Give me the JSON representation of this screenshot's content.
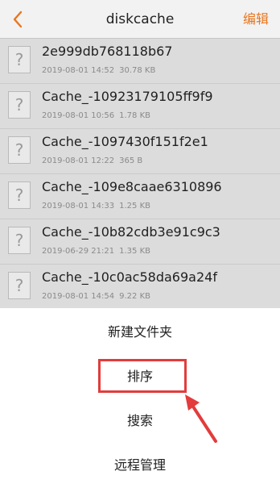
{
  "header": {
    "title": "diskcache",
    "edit_label": "编辑",
    "back_icon": "chevron-left-icon"
  },
  "files": [
    {
      "name": "2e999db768118b67",
      "date": "2019-08-01 14:52",
      "size": "30.78 KB"
    },
    {
      "name": "Cache_-10923179105ff9f9",
      "date": "2019-08-01 10:56",
      "size": "1.78 KB"
    },
    {
      "name": "Cache_-1097430f151f2e1",
      "date": "2019-08-01 12:22",
      "size": "365 B"
    },
    {
      "name": "Cache_-109e8caae6310896",
      "date": "2019-08-01 14:33",
      "size": "1.25 KB"
    },
    {
      "name": "Cache_-10b82cdb3e91c9c3",
      "date": "2019-06-29 21:21",
      "size": "1.35 KB"
    },
    {
      "name": "Cache_-10c0ac58da69a24f",
      "date": "2019-08-01 14:54",
      "size": "9.22 KB"
    }
  ],
  "file_icon_glyph": "?",
  "menu": {
    "new_folder": "新建文件夹",
    "sort": "排序",
    "search": "搜索",
    "remote": "远程管理"
  },
  "colors": {
    "accent": "#e8761f",
    "highlight": "#e23c3c"
  }
}
